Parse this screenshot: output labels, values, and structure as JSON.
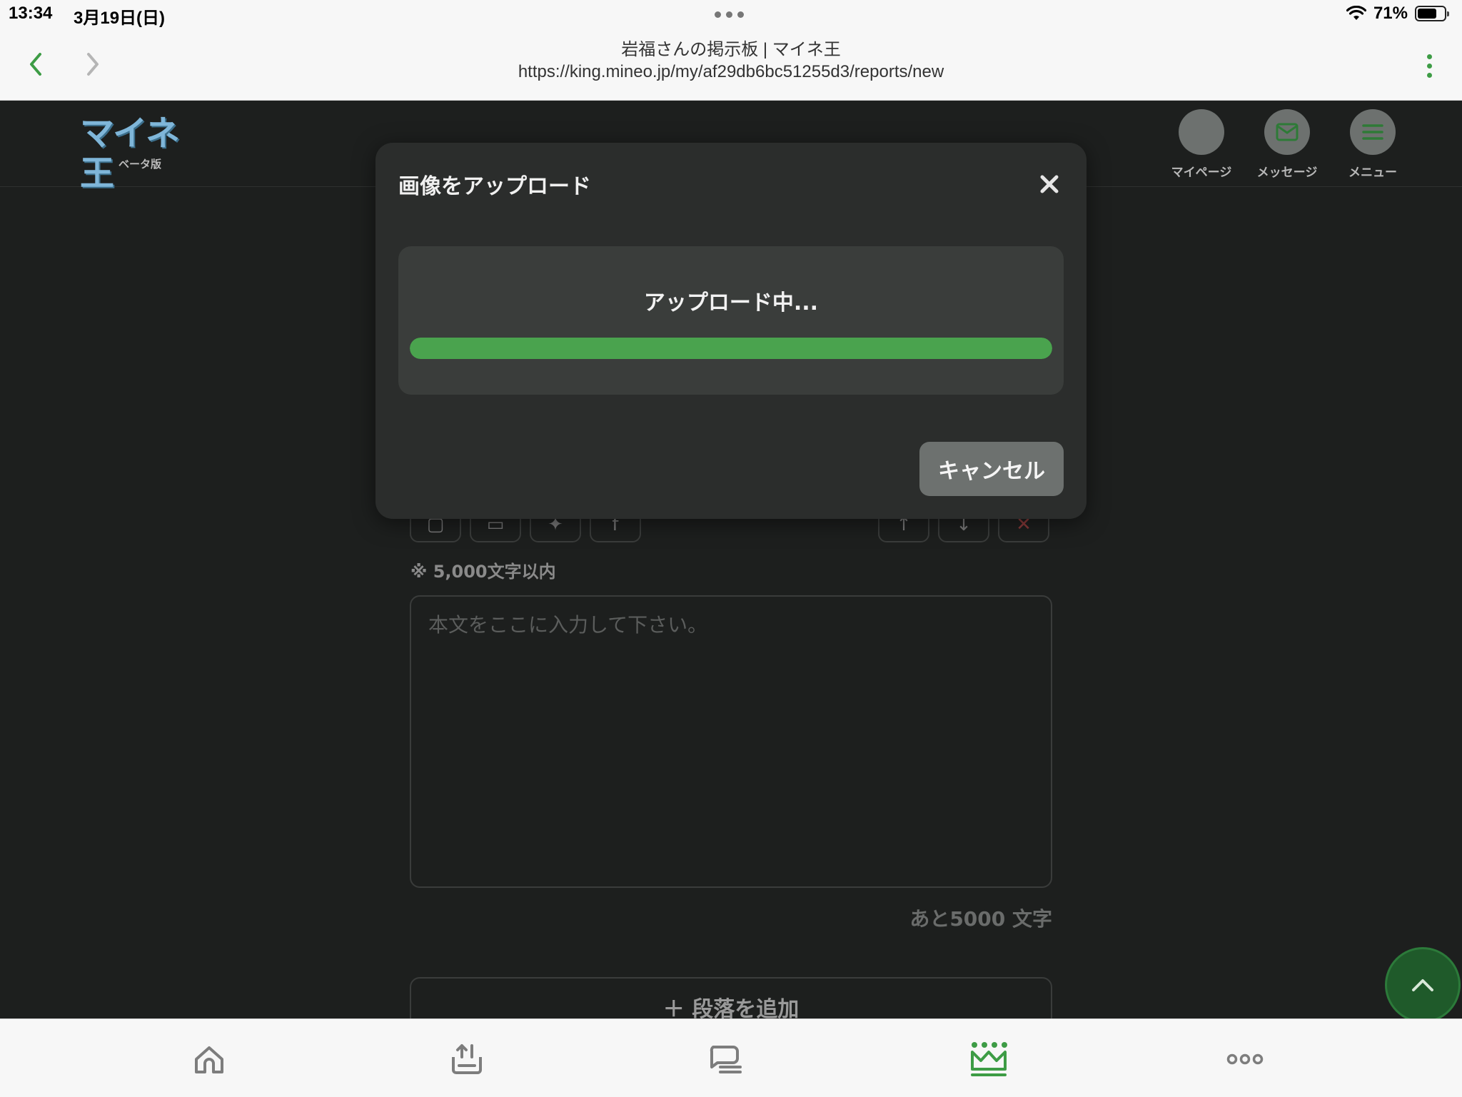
{
  "status_bar": {
    "time": "13:34",
    "date": "3月19日(日)",
    "battery": "71%",
    "battery_level": 0.71
  },
  "browser": {
    "page_title": "岩福さんの掲示板 | マイネ王",
    "url": "https://king.mineo.jp/my/af29db6bc51255d3/reports/new"
  },
  "site_header": {
    "logo_text": "マイネ王",
    "logo_sub": "ベータ版",
    "nav": [
      {
        "label": "マイページ",
        "icon": "avatar"
      },
      {
        "label": "メッセージ",
        "icon": "envelope-icon"
      },
      {
        "label": "メニュー",
        "icon": "hamburger-icon"
      }
    ]
  },
  "modal": {
    "title": "画像をアップロード",
    "status": "アップロード中...",
    "progress": 1.0,
    "cancel_label": "キャンセル",
    "accent_color": "#4aa34e"
  },
  "editor": {
    "limit_note": "※ 5,000文字以内",
    "textarea_placeholder": "本文をここに入力して下さい。",
    "remaining": "あと5000 文字",
    "add_paragraph": "＋ 段落を追加"
  },
  "tabbar": [
    "home-icon",
    "upload-icon",
    "chat-icon",
    "crown-icon",
    "more-icon"
  ],
  "colors": {
    "brand_green": "#3d9c45",
    "background": "#1d1f1e",
    "modal_bg": "#2b2d2c"
  }
}
